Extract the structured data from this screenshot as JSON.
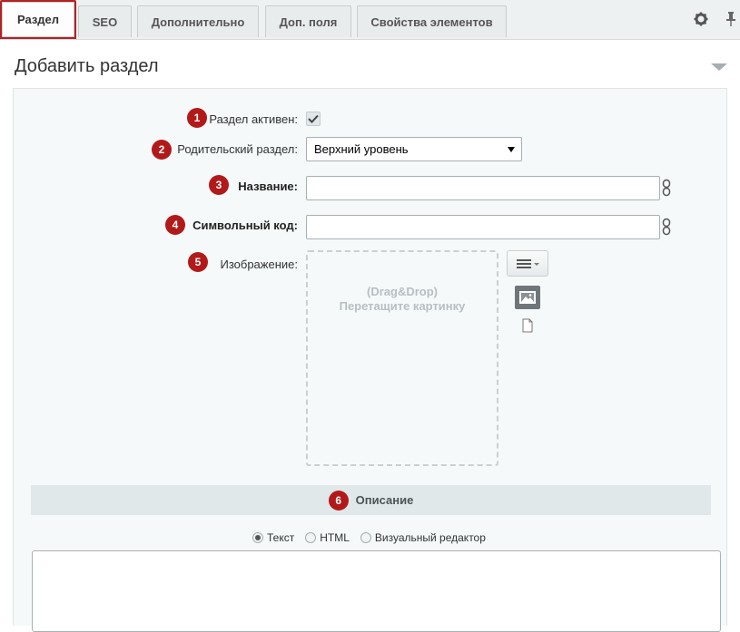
{
  "tabs": [
    {
      "label": "Раздел",
      "active": true
    },
    {
      "label": "SEO",
      "active": false
    },
    {
      "label": "Дополнительно",
      "active": false
    },
    {
      "label": "Доп. поля",
      "active": false
    },
    {
      "label": "Свойства элементов",
      "active": false
    }
  ],
  "tab_icons": [
    "gear-icon",
    "pin-icon"
  ],
  "panel": {
    "title": "Добавить раздел"
  },
  "fields": {
    "active": {
      "num": "1",
      "label": "Раздел активен:",
      "checked": true
    },
    "parent": {
      "num": "2",
      "label": "Родительский раздел:",
      "value": "Верхний уровень"
    },
    "name": {
      "num": "3",
      "label": "Название:",
      "value": ""
    },
    "code": {
      "num": "4",
      "label": "Символьный код:",
      "value": ""
    },
    "image": {
      "num": "5",
      "label": "Изображение:",
      "drop_line1": "(Drag&Drop)",
      "drop_line2": "Перетащите картинку"
    }
  },
  "description": {
    "num": "6",
    "title": "Описание",
    "modes": [
      {
        "label": "Текст",
        "selected": true
      },
      {
        "label": "HTML",
        "selected": false
      },
      {
        "label": "Визуальный редактор",
        "selected": false
      }
    ],
    "value": ""
  },
  "colors": {
    "accent_red": "#b21a1a",
    "form_bg": "#f5f9f9",
    "section_bg": "#e0e8ea"
  }
}
